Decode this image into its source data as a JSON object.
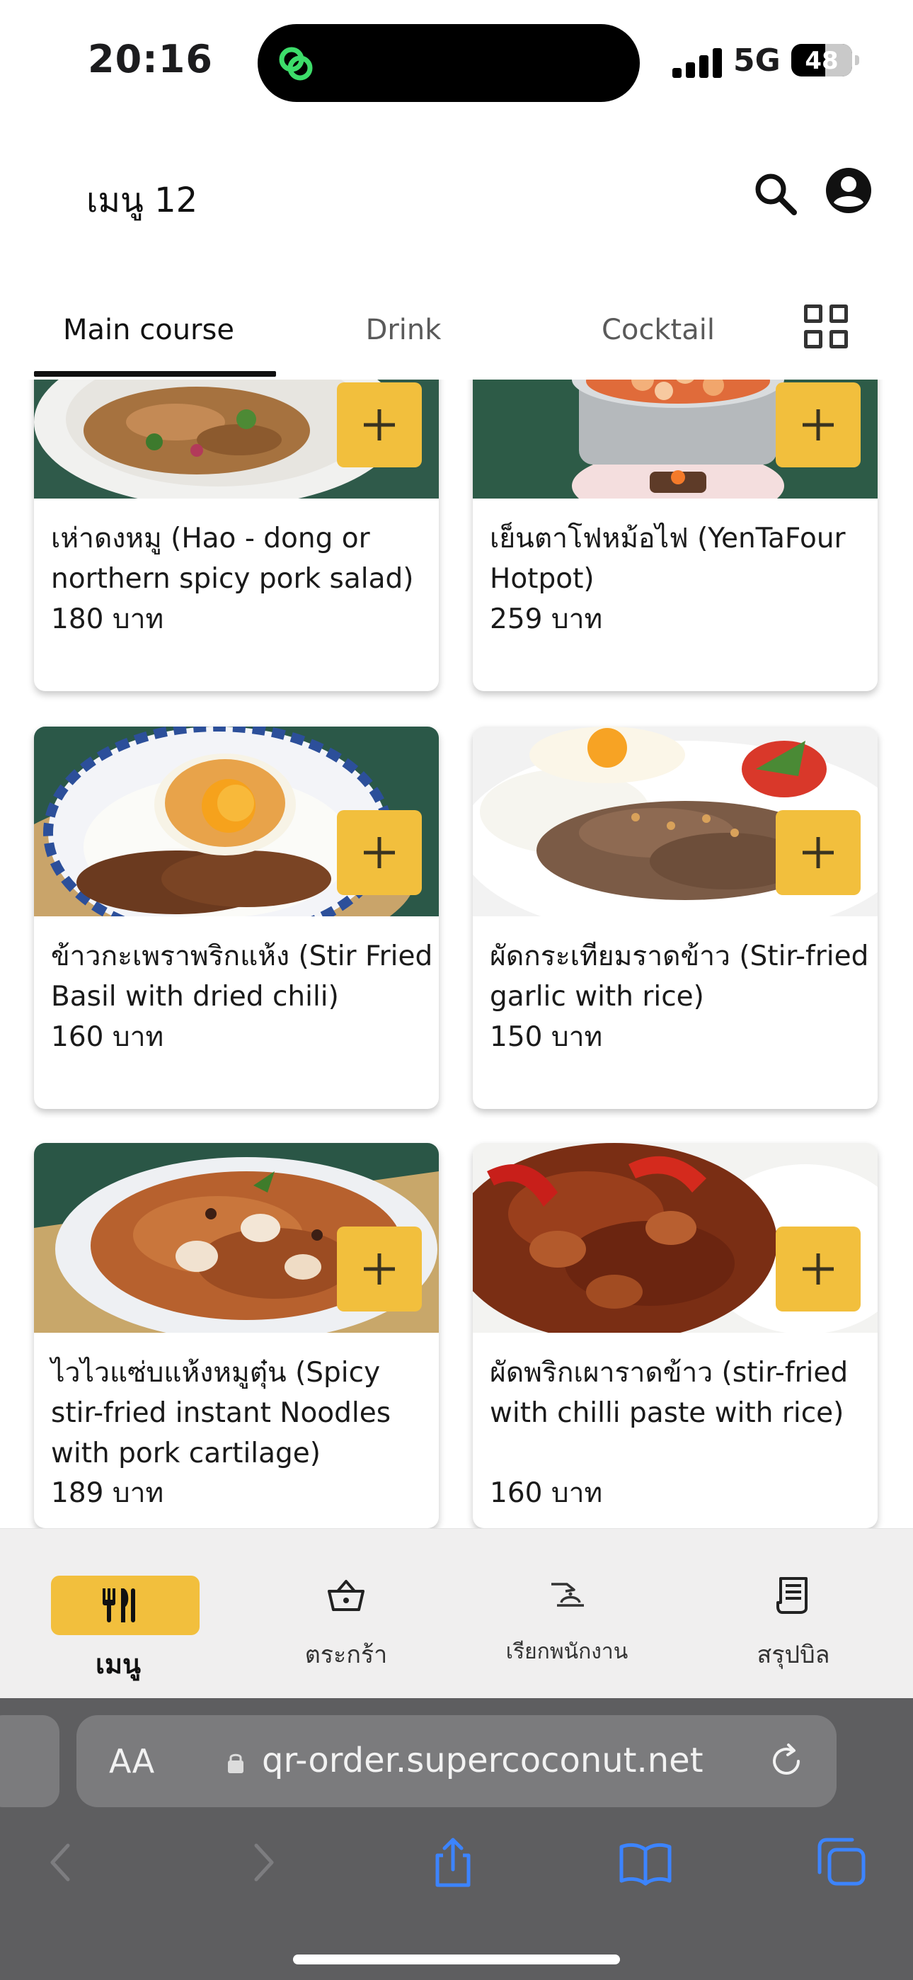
{
  "status_bar": {
    "time": "20:16",
    "network": "5G",
    "battery": "48"
  },
  "header": {
    "title": "เมนู 12"
  },
  "tabs": [
    {
      "label": "Main course",
      "active": true
    },
    {
      "label": "Drink",
      "active": false
    },
    {
      "label": "Cocktail",
      "active": false
    }
  ],
  "menu_items": [
    {
      "name": "เห่าดงหมู (Hao - dong or northern spicy pork salad)",
      "price": "180 บาท",
      "image": "pork-salad"
    },
    {
      "name": "เย็นตาโฟหม้อไฟ (YenTaFour Hotpot)",
      "price": "259 บาท",
      "image": "hotpot"
    },
    {
      "name": "ข้าวกะเพราพริกแห้ง (Stir Fried Basil with dried chili)",
      "price": "160 บาท",
      "image": "basil-rice-egg"
    },
    {
      "name": "ผัดกระเทียมราดข้าว (Stir-fried garlic with rice)",
      "price": "150 บาท",
      "image": "garlic-pork-rice"
    },
    {
      "name": "ไวไวแซ่บแห้งหมูตุ๋น (Spicy stir-fried instant Noodles with pork cartilage)",
      "price": "189 บาท",
      "image": "spicy-noodles"
    },
    {
      "name": "ผัดพริกเผาราดข้าว (stir-fried with chilli paste with rice)",
      "price": "160 บาท",
      "image": "chilli-paste-rice"
    }
  ],
  "bottom_nav": [
    {
      "label": "เมนู",
      "icon": "utensils-icon",
      "active": true
    },
    {
      "label": "ตระกร้า",
      "icon": "basket-icon",
      "active": false
    },
    {
      "label": "เรียกพนักงาน",
      "icon": "call-staff-icon",
      "active": false
    },
    {
      "label": "สรุปบิล",
      "icon": "receipt-icon",
      "active": false
    }
  ],
  "browser": {
    "aa_label": "AA",
    "url": "qr-order.supercoconut.net"
  },
  "colors": {
    "accent": "#f2bf3d",
    "nav_bg": "#f0efef",
    "safari_bg": "#5e5e60"
  }
}
